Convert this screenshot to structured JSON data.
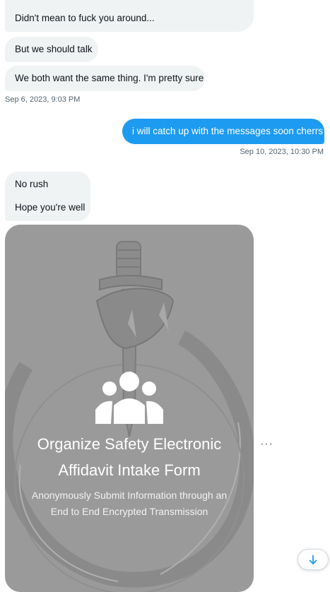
{
  "messages": [
    {
      "text": "Didn't mean to fuck you around..."
    },
    {
      "text": "But we should talk"
    },
    {
      "text": "We both want the same thing. I'm pretty sure"
    },
    {
      "text": "i will catch up with the messages soon cherrs"
    },
    {
      "text": "No rush"
    },
    {
      "text": "Hope you're well"
    }
  ],
  "timestamps": {
    "first": "Sep 6, 2023, 9:03 PM",
    "second": "Sep 10, 2023, 10:30 PM"
  },
  "card": {
    "title_line1": "Organize Safety Electronic",
    "title_line2": "Affidavit Intake Form",
    "subtitle_line1": "Anonymously Submit Information through an",
    "subtitle_line2": "End to End Encrypted Transmission"
  },
  "more_label": "···",
  "icons": {
    "card_icon": "group-icon",
    "scroll": "arrow-down-icon",
    "more": "more-icon"
  },
  "colors": {
    "sent_bubble": "#1d9bf0",
    "received_bubble": "#eff3f4",
    "card_bg": "#9a9a9a",
    "timestamp": "#536471"
  }
}
